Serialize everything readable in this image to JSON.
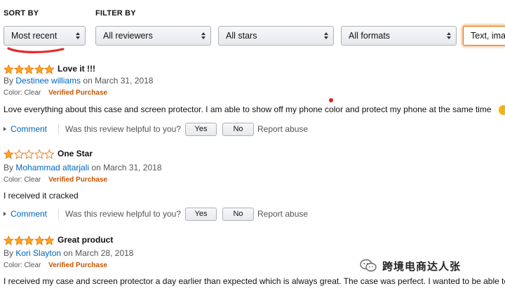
{
  "header": {
    "sort_label": "SORT BY",
    "filter_label": "FILTER BY"
  },
  "filters": {
    "sort": "Most recent",
    "reviewers": "All reviewers",
    "stars": "All stars",
    "formats": "All formats",
    "media": "Text, ima"
  },
  "reviews": [
    {
      "rating": 5,
      "title": "Love it !!!",
      "by": "By",
      "author": "Destinee williams",
      "date": "on March 31, 2018",
      "color": "Color: Clear",
      "verified": "Verified Purchase",
      "body": "Love everything about this case and screen protector. I am able to show off my phone color and protect my phone at the same time"
    },
    {
      "rating": 1,
      "title": "One Star",
      "by": "By",
      "author": "Mohammad altarjali",
      "date": "on March 31, 2018",
      "color": "Color: Clear",
      "verified": "Verified Purchase",
      "body": "I received it cracked"
    },
    {
      "rating": 5,
      "title": "Great product",
      "by": "By",
      "author": "Kori Slayton",
      "date": "on March 28, 2018",
      "color": "Color: Clear",
      "verified": "Verified Purchase",
      "body": "I received my case and screen protector a day earlier than expected which is always great. The case was perfect. I wanted to be able to"
    }
  ],
  "actions": {
    "comment": "Comment",
    "helpful_prompt": "Was this review helpful to you?",
    "yes": "Yes",
    "no": "No",
    "report": "Report abuse"
  },
  "watermark": {
    "text": "跨境电商达人张"
  },
  "colors": {
    "star": "#ffa41c",
    "link": "#0066c0",
    "verified": "#c45500",
    "annotation": "#e8282a"
  }
}
